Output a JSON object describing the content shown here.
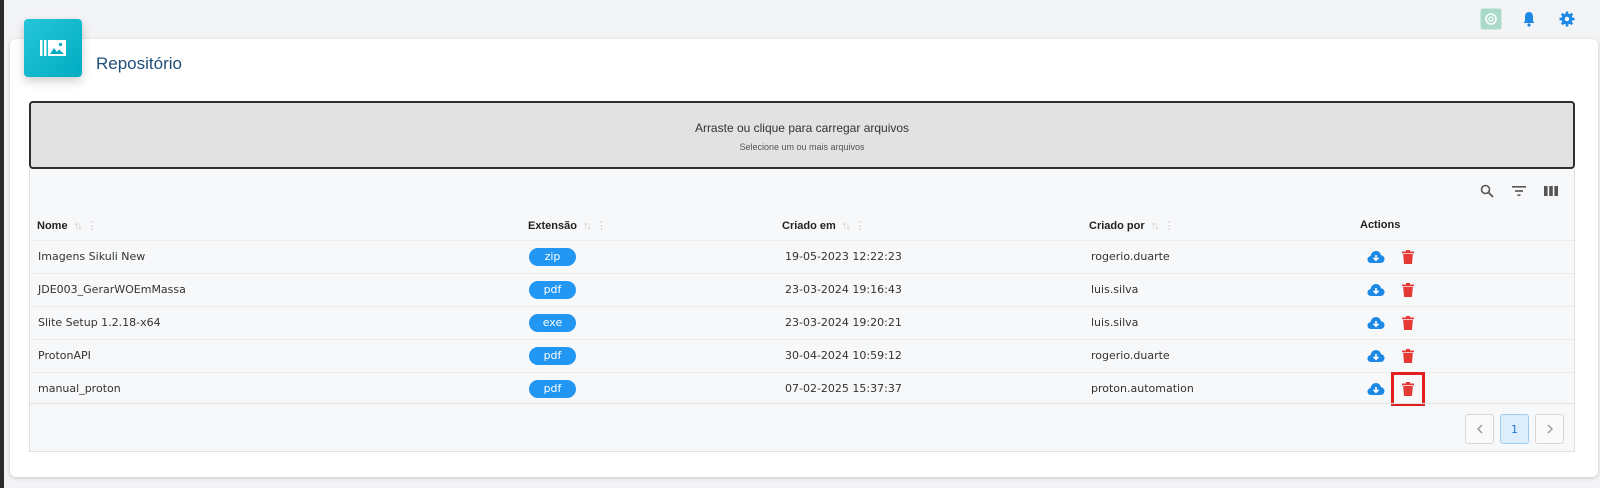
{
  "page": {
    "title": "Repositório"
  },
  "dropzone": {
    "title": "Arraste ou clique para carregar arquivos",
    "subtitle": "Selecione um ou mais arquivos"
  },
  "table": {
    "columns": [
      "Nome",
      "Extensão",
      "Criado em",
      "Criado por",
      "Actions"
    ],
    "rows": [
      {
        "name": "Imagens Sikuli New",
        "ext": "zip",
        "created": "19-05-2023 12:22:23",
        "by": "rogerio.duarte"
      },
      {
        "name": "JDE003_GerarWOEmMassa",
        "ext": "pdf",
        "created": "23-03-2024 19:16:43",
        "by": "luis.silva"
      },
      {
        "name": "Slite Setup 1.2.18-x64",
        "ext": "exe",
        "created": "23-03-2024 19:20:21",
        "by": "luis.silva"
      },
      {
        "name": "ProtonAPI",
        "ext": "pdf",
        "created": "30-04-2024 10:59:12",
        "by": "rogerio.duarte"
      },
      {
        "name": "manual_proton",
        "ext": "pdf",
        "created": "07-02-2025 15:37:37",
        "by": "proton.automation"
      }
    ]
  },
  "pagination": {
    "current_page": "1"
  },
  "colors": {
    "accent": "#2196f3",
    "delete": "#e53935",
    "badge": "#00acc1",
    "title": "#1f4e79"
  },
  "icons": [
    "chatgpt-icon",
    "bell-icon",
    "gear-icon",
    "gallery-icon",
    "search-icon",
    "filter-icon",
    "columns-icon",
    "cloud-download-icon",
    "trash-icon",
    "chevron-left-icon",
    "chevron-right-icon"
  ]
}
